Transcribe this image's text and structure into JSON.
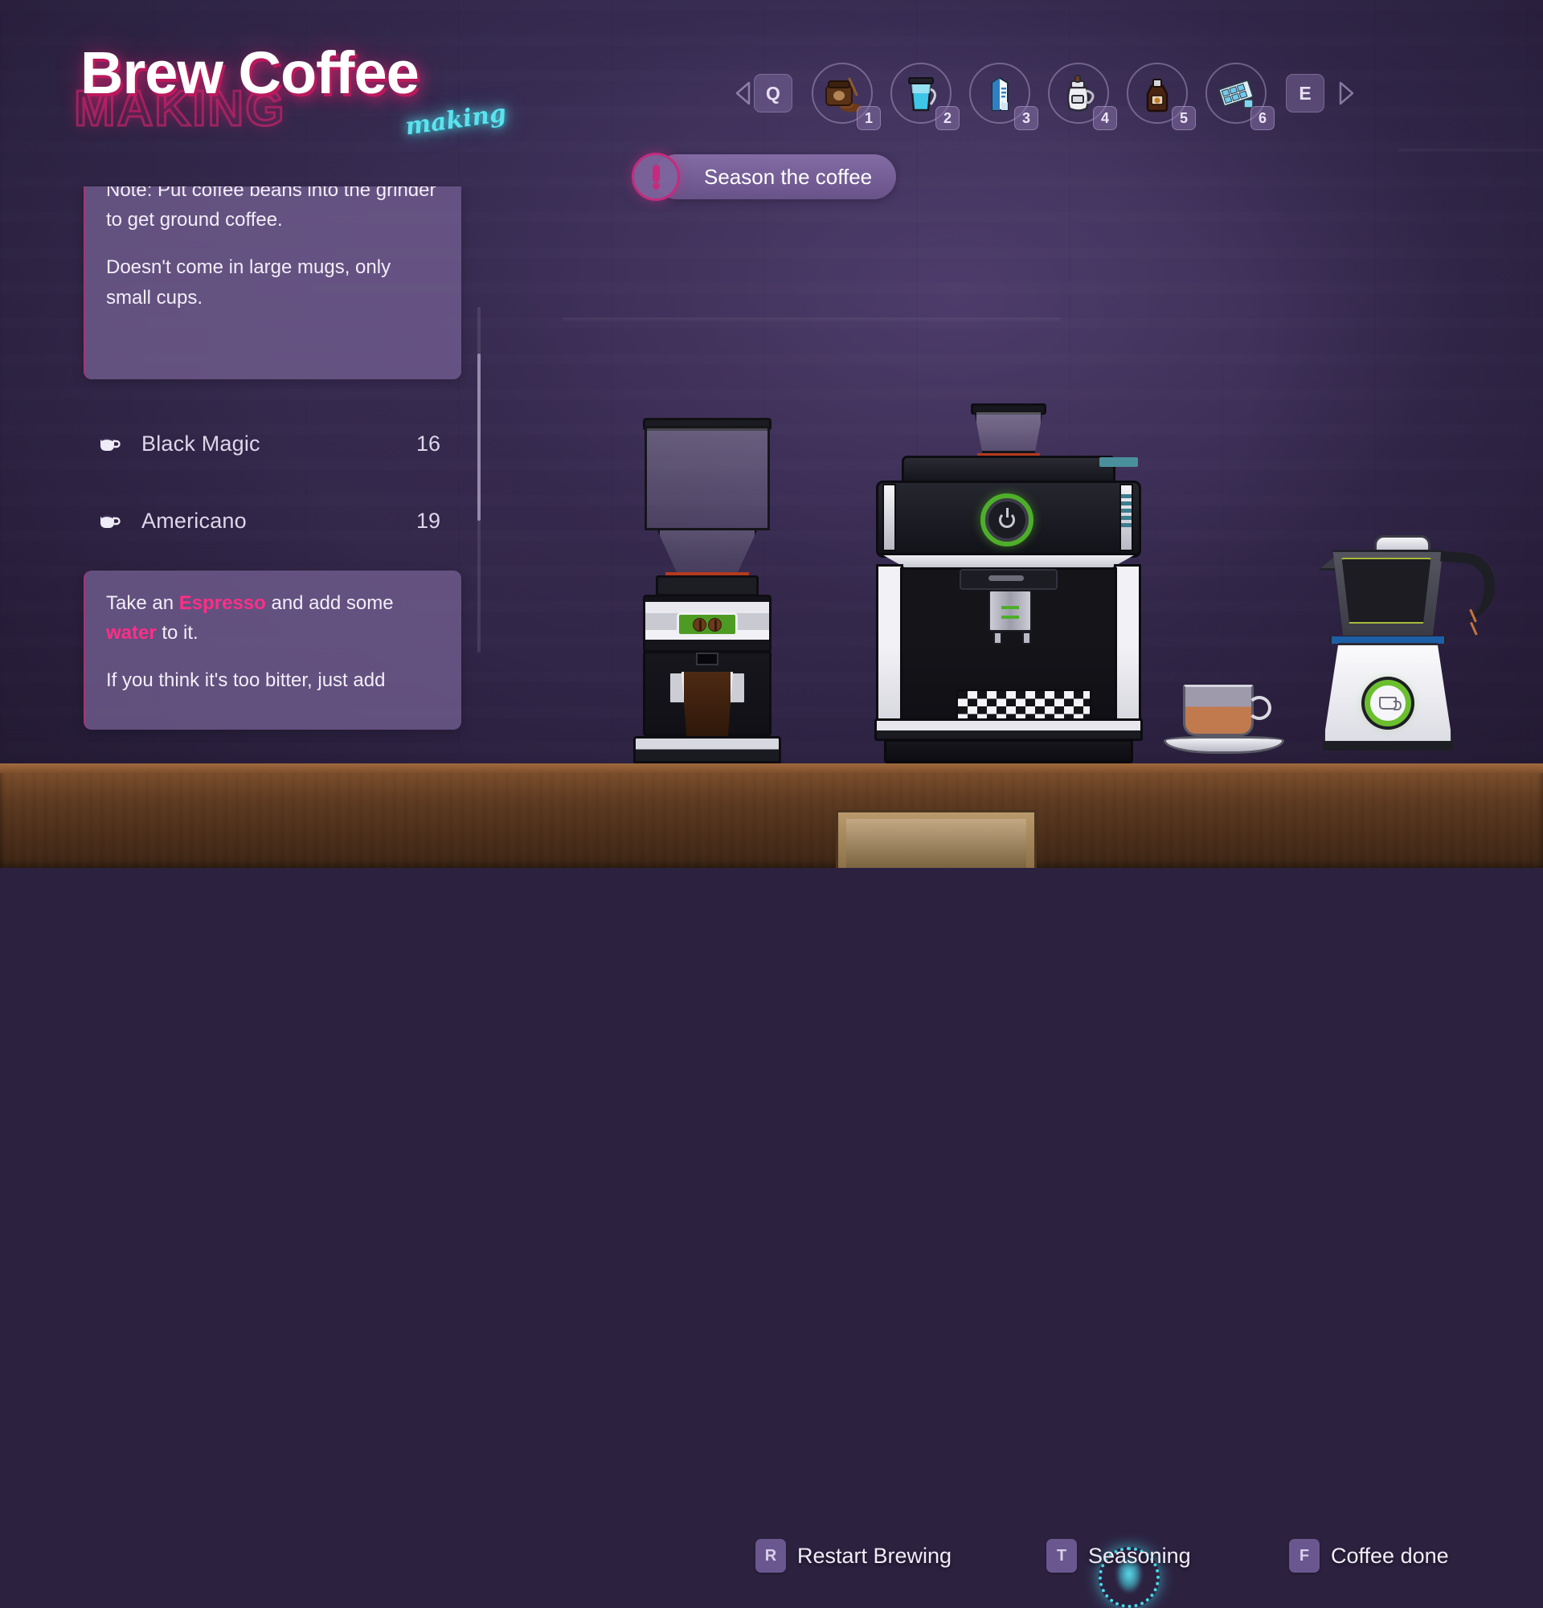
{
  "title": {
    "main": "Brew Coffee",
    "ghost": "MAKING",
    "script": "making"
  },
  "objective": {
    "text": "Season the coffee",
    "icon": "exclamation-icon",
    "accent_color": "#c42b7e"
  },
  "toolbar": {
    "prev_arrow": "◀",
    "next_arrow": "▶",
    "left_key": "Q",
    "right_key": "E",
    "slots": [
      {
        "number": "1",
        "icon": "ground-coffee-jar-icon",
        "name": "Ground Coffee"
      },
      {
        "number": "2",
        "icon": "water-pitcher-icon",
        "name": "Water"
      },
      {
        "number": "3",
        "icon": "milk-carton-icon",
        "name": "Milk"
      },
      {
        "number": "4",
        "icon": "cream-pitcher-icon",
        "name": "Cream"
      },
      {
        "number": "5",
        "icon": "syrup-bottle-icon",
        "name": "Syrup"
      },
      {
        "number": "6",
        "icon": "ice-cube-tray-icon",
        "name": "Ice"
      }
    ]
  },
  "recipe_panel": {
    "note_top": [
      "Note: Put coffee beans into the grinder to get ground coffee.",
      "Doesn't come in large mugs, only small cups."
    ],
    "recipes": [
      {
        "icon": "coffee-cup-icon",
        "name": "Black Magic",
        "count": "16"
      },
      {
        "icon": "coffee-cup-icon",
        "name": "Americano",
        "count": "19"
      }
    ],
    "note_bottom": {
      "line1_pre": "Take an ",
      "line1_kw1": "Espresso",
      "line1_mid": " and add some ",
      "line1_kw2": "water",
      "line1_post": " to it.",
      "line2": "If you think it's too bitter, just add"
    },
    "keyword_color": "#ff2e86"
  },
  "actions": [
    {
      "key": "R",
      "label": "Restart Brewing",
      "name": "restart-brewing"
    },
    {
      "key": "T",
      "label": "Seasoning",
      "name": "seasoning"
    },
    {
      "key": "F",
      "label": "Coffee done",
      "name": "coffee-done"
    }
  ],
  "cursor": {
    "color": "#49d8e8"
  },
  "appliances": {
    "grinder": "coffee-grinder",
    "espresso_machine": "espresso-machine",
    "cup": "coffee-cup-on-saucer",
    "frother": "milk-frother"
  }
}
